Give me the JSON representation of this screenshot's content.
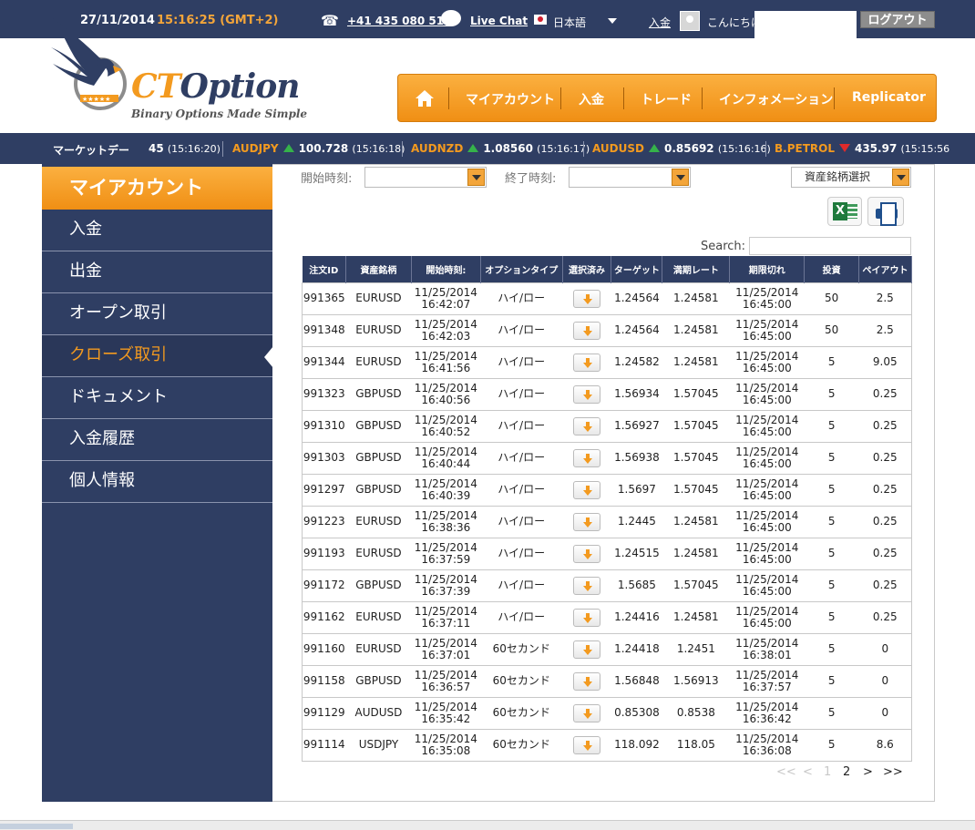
{
  "topbar": {
    "date": "27/11/2014",
    "time": "15:16:25  (GMT+2)",
    "phone": "+41 435 080 510",
    "live_chat": "Live Chat",
    "language": "日本語",
    "deposit_link": "入金",
    "greeting": "こんにちは",
    "logout": "ログアウト"
  },
  "header": {
    "logo_ct": "CT",
    "logo_option": "Option",
    "tagline": "Binary Options Made Simple",
    "nav": [
      "マイアカウント",
      "入金",
      "トレード",
      "インフォメーション",
      "Replicator"
    ]
  },
  "ticker": {
    "label": "マーケットデー",
    "first": {
      "price": "45",
      "time": "(15:16:20)"
    },
    "items": [
      {
        "symbol": "AUDJPY",
        "dir": "up",
        "price": "100.728",
        "time": "(15:16:18)"
      },
      {
        "symbol": "AUDNZD",
        "dir": "up",
        "price": "1.08560",
        "time": "(15:16:17)"
      },
      {
        "symbol": "AUDUSD",
        "dir": "up",
        "price": "0.85692",
        "time": "(15:16:16)"
      },
      {
        "symbol": "B.PETROL",
        "dir": "down",
        "price": "435.97",
        "time": "(15:15:56"
      }
    ]
  },
  "sidebar": {
    "title": "マイアカウント",
    "items": [
      "入金",
      "出金",
      "オープン取引",
      "クローズ取引",
      "ドキュメント",
      "入金履歴",
      "個人情報"
    ],
    "active_index": 3
  },
  "filters": {
    "start_label": "開始時刻:",
    "end_label": "終了時刻:",
    "asset_select": "資産銘柄選択",
    "search_label": "Search:"
  },
  "table": {
    "headers": [
      "注文ID",
      "資産銘柄",
      "開始時刻:",
      "オプションタイプ",
      "選択済み",
      "ターゲット",
      "満期レート",
      "期限切れ",
      "投資",
      "ペイアウト"
    ],
    "rows": [
      {
        "id": "991365",
        "asset": "EURUSD",
        "start_date": "11/25/2014",
        "start_time": "16:42:07",
        "type": "ハイ/ロー",
        "target": "1.24564",
        "rate": "1.24581",
        "exp_date": "11/25/2014",
        "exp_time": "16:45:00",
        "invest": "50",
        "payout": "2.5"
      },
      {
        "id": "991348",
        "asset": "EURUSD",
        "start_date": "11/25/2014",
        "start_time": "16:42:03",
        "type": "ハイ/ロー",
        "target": "1.24564",
        "rate": "1.24581",
        "exp_date": "11/25/2014",
        "exp_time": "16:45:00",
        "invest": "50",
        "payout": "2.5"
      },
      {
        "id": "991344",
        "asset": "EURUSD",
        "start_date": "11/25/2014",
        "start_time": "16:41:56",
        "type": "ハイ/ロー",
        "target": "1.24582",
        "rate": "1.24581",
        "exp_date": "11/25/2014",
        "exp_time": "16:45:00",
        "invest": "5",
        "payout": "9.05"
      },
      {
        "id": "991323",
        "asset": "GBPUSD",
        "start_date": "11/25/2014",
        "start_time": "16:40:56",
        "type": "ハイ/ロー",
        "target": "1.56934",
        "rate": "1.57045",
        "exp_date": "11/25/2014",
        "exp_time": "16:45:00",
        "invest": "5",
        "payout": "0.25"
      },
      {
        "id": "991310",
        "asset": "GBPUSD",
        "start_date": "11/25/2014",
        "start_time": "16:40:52",
        "type": "ハイ/ロー",
        "target": "1.56927",
        "rate": "1.57045",
        "exp_date": "11/25/2014",
        "exp_time": "16:45:00",
        "invest": "5",
        "payout": "0.25"
      },
      {
        "id": "991303",
        "asset": "GBPUSD",
        "start_date": "11/25/2014",
        "start_time": "16:40:44",
        "type": "ハイ/ロー",
        "target": "1.56938",
        "rate": "1.57045",
        "exp_date": "11/25/2014",
        "exp_time": "16:45:00",
        "invest": "5",
        "payout": "0.25"
      },
      {
        "id": "991297",
        "asset": "GBPUSD",
        "start_date": "11/25/2014",
        "start_time": "16:40:39",
        "type": "ハイ/ロー",
        "target": "1.5697",
        "rate": "1.57045",
        "exp_date": "11/25/2014",
        "exp_time": "16:45:00",
        "invest": "5",
        "payout": "0.25"
      },
      {
        "id": "991223",
        "asset": "EURUSD",
        "start_date": "11/25/2014",
        "start_time": "16:38:36",
        "type": "ハイ/ロー",
        "target": "1.2445",
        "rate": "1.24581",
        "exp_date": "11/25/2014",
        "exp_time": "16:45:00",
        "invest": "5",
        "payout": "0.25"
      },
      {
        "id": "991193",
        "asset": "EURUSD",
        "start_date": "11/25/2014",
        "start_time": "16:37:59",
        "type": "ハイ/ロー",
        "target": "1.24515",
        "rate": "1.24581",
        "exp_date": "11/25/2014",
        "exp_time": "16:45:00",
        "invest": "5",
        "payout": "0.25"
      },
      {
        "id": "991172",
        "asset": "GBPUSD",
        "start_date": "11/25/2014",
        "start_time": "16:37:39",
        "type": "ハイ/ロー",
        "target": "1.5685",
        "rate": "1.57045",
        "exp_date": "11/25/2014",
        "exp_time": "16:45:00",
        "invest": "5",
        "payout": "0.25"
      },
      {
        "id": "991162",
        "asset": "EURUSD",
        "start_date": "11/25/2014",
        "start_time": "16:37:11",
        "type": "ハイ/ロー",
        "target": "1.24416",
        "rate": "1.24581",
        "exp_date": "11/25/2014",
        "exp_time": "16:45:00",
        "invest": "5",
        "payout": "0.25"
      },
      {
        "id": "991160",
        "asset": "EURUSD",
        "start_date": "11/25/2014",
        "start_time": "16:37:01",
        "type": "60セカンド",
        "target": "1.24418",
        "rate": "1.2451",
        "exp_date": "11/25/2014",
        "exp_time": "16:38:01",
        "invest": "5",
        "payout": "0"
      },
      {
        "id": "991158",
        "asset": "GBPUSD",
        "start_date": "11/25/2014",
        "start_time": "16:36:57",
        "type": "60セカンド",
        "target": "1.56848",
        "rate": "1.56913",
        "exp_date": "11/25/2014",
        "exp_time": "16:37:57",
        "invest": "5",
        "payout": "0"
      },
      {
        "id": "991129",
        "asset": "AUDUSD",
        "start_date": "11/25/2014",
        "start_time": "16:35:42",
        "type": "60セカンド",
        "target": "0.85308",
        "rate": "0.8538",
        "exp_date": "11/25/2014",
        "exp_time": "16:36:42",
        "invest": "5",
        "payout": "0"
      },
      {
        "id": "991114",
        "asset": "USDJPY",
        "start_date": "11/25/2014",
        "start_time": "16:35:08",
        "type": "60セカンド",
        "target": "118.092",
        "rate": "118.05",
        "exp_date": "11/25/2014",
        "exp_time": "16:36:08",
        "invest": "5",
        "payout": "8.6"
      }
    ]
  },
  "pagination": {
    "first": "<<",
    "prev": "<",
    "pages": [
      "1",
      "2"
    ],
    "current": "2",
    "next": ">",
    "last": ">>"
  },
  "colors": {
    "navy": "#2f3e63",
    "orange": "#f39a1f",
    "up": "#35b24a",
    "down": "#e02a2a"
  }
}
